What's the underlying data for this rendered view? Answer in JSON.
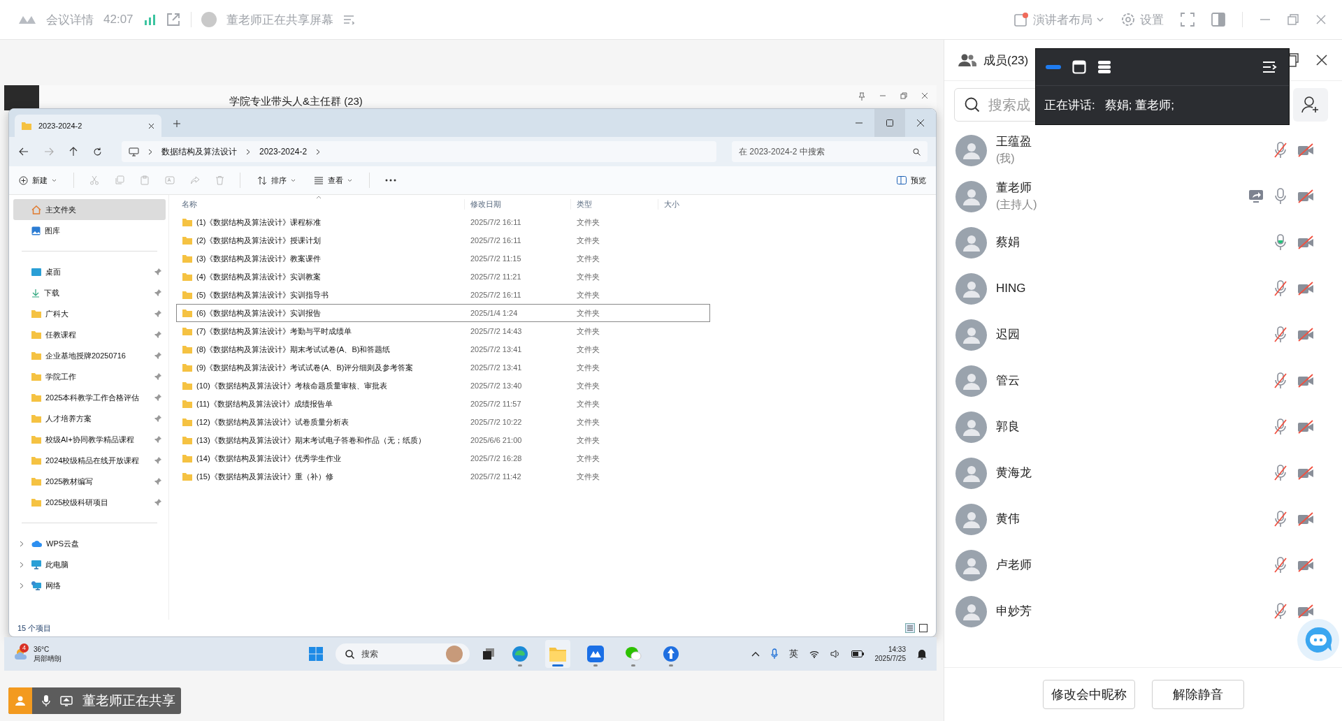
{
  "meeting_bar": {
    "title": "会议详情",
    "duration": "42:07",
    "sharing_status": "董老师正在共享屏幕",
    "layout_button": "演讲者布局",
    "settings_button": "设置"
  },
  "shared_screen": {
    "background_window": {
      "title": "学院专业带头人&主任群 (23)"
    },
    "explorer": {
      "tab": {
        "title": "2023-2024-2"
      },
      "breadcrumb": [
        "数据结构及算法设计",
        "2023-2024-2"
      ],
      "search": {
        "placeholder": "在 2023-2024-2 中搜索"
      },
      "toolbar": {
        "new": "新建",
        "sort": "排序",
        "view": "查看",
        "preview": "预览"
      },
      "sidebar": {
        "sections": [
          [
            {
              "label": "主文件夹",
              "kind": "home",
              "selected": true,
              "pinned": false
            },
            {
              "label": "图库",
              "kind": "gallery",
              "selected": false,
              "pinned": false
            }
          ],
          [
            {
              "label": "桌面",
              "kind": "desktop",
              "selected": false,
              "pinned": true
            },
            {
              "label": "下载",
              "kind": "download",
              "selected": false,
              "pinned": true
            },
            {
              "label": "广科大",
              "kind": "folder",
              "selected": false,
              "pinned": true
            },
            {
              "label": "任教课程",
              "kind": "folder",
              "selected": false,
              "pinned": true
            },
            {
              "label": "企业基地授牌20250716",
              "kind": "folder",
              "selected": false,
              "pinned": true
            },
            {
              "label": "学院工作",
              "kind": "folder",
              "selected": false,
              "pinned": true
            },
            {
              "label": "2025本科教学工作合格评估",
              "kind": "folder",
              "selected": false,
              "pinned": true
            },
            {
              "label": "人才培养方案",
              "kind": "folder",
              "selected": false,
              "pinned": true
            },
            {
              "label": "校级AI+协同教学精品课程",
              "kind": "folder",
              "selected": false,
              "pinned": true
            },
            {
              "label": "2024校级精品在线开放课程",
              "kind": "folder",
              "selected": false,
              "pinned": true
            },
            {
              "label": "2025教材编写",
              "kind": "folder",
              "selected": false,
              "pinned": true
            },
            {
              "label": "2025校级科研项目",
              "kind": "folder",
              "selected": false,
              "pinned": true
            }
          ],
          [
            {
              "label": "WPS云盘",
              "kind": "cloud",
              "selected": false,
              "pinned": false,
              "expanded": false
            },
            {
              "label": "此电脑",
              "kind": "computer",
              "selected": false,
              "pinned": false,
              "expanded": false
            },
            {
              "label": "网络",
              "kind": "network",
              "selected": false,
              "pinned": false,
              "expanded": false
            }
          ]
        ]
      },
      "columns": [
        "名称",
        "修改日期",
        "类型",
        "大小"
      ],
      "rows": [
        {
          "name": "(1)《数据结构及算法设计》课程标准",
          "modified": "2025/7/2 16:11",
          "type": "文件夹",
          "selected": false
        },
        {
          "name": "(2)《数据结构及算法设计》授课计划",
          "modified": "2025/7/2 16:11",
          "type": "文件夹",
          "selected": false
        },
        {
          "name": "(3)《数据结构及算法设计》教案课件",
          "modified": "2025/7/2 11:15",
          "type": "文件夹",
          "selected": false
        },
        {
          "name": "(4)《数据结构及算法设计》实训教案",
          "modified": "2025/7/2 11:21",
          "type": "文件夹",
          "selected": false
        },
        {
          "name": "(5)《数据结构及算法设计》实训指导书",
          "modified": "2025/7/2 16:11",
          "type": "文件夹",
          "selected": false
        },
        {
          "name": "(6)《数据结构及算法设计》实训报告",
          "modified": "2025/1/4 1:24",
          "type": "文件夹",
          "selected": true
        },
        {
          "name": "(7)《数据结构及算法设计》考勤与平时成绩单",
          "modified": "2025/7/2 14:43",
          "type": "文件夹",
          "selected": false
        },
        {
          "name": "(8)《数据结构及算法设计》期末考试试卷(A、B)和答题纸",
          "modified": "2025/7/2 13:41",
          "type": "文件夹",
          "selected": false
        },
        {
          "name": "(9)《数据结构及算法设计》考试试卷(A、B)评分细则及参考答案",
          "modified": "2025/7/2 13:41",
          "type": "文件夹",
          "selected": false
        },
        {
          "name": "(10)《数据结构及算法设计》考核命题质量审核、审批表",
          "modified": "2025/7/2 13:40",
          "type": "文件夹",
          "selected": false
        },
        {
          "name": "(11)《数据结构及算法设计》成绩报告单",
          "modified": "2025/7/2 11:57",
          "type": "文件夹",
          "selected": false
        },
        {
          "name": "(12)《数据结构及算法设计》试卷质量分析表",
          "modified": "2025/7/2 10:22",
          "type": "文件夹",
          "selected": false
        },
        {
          "name": "(13)《数据结构及算法设计》期末考试电子答卷和作品（无；纸质）",
          "modified": "2025/6/6 21:00",
          "type": "文件夹",
          "selected": false
        },
        {
          "name": "(14)《数据结构及算法设计》优秀学生作业",
          "modified": "2025/7/2 16:28",
          "type": "文件夹",
          "selected": false
        },
        {
          "name": "(15)《数据结构及算法设计》重（补）修",
          "modified": "2025/7/2 11:42",
          "type": "文件夹",
          "selected": false
        }
      ],
      "status": "15 个项目"
    },
    "taskbar": {
      "weather": {
        "badge": "4",
        "temperature": "36°C",
        "condition": "局部晴朗"
      },
      "search": {
        "placeholder": "搜索"
      },
      "ime": "英",
      "time": "14:33",
      "date": "2025/7/25"
    }
  },
  "sharing_badge": {
    "text": "董老师正在共享"
  },
  "members_panel": {
    "title": "成员(23)",
    "search": {
      "placeholder": "搜索成"
    },
    "speaking": {
      "label": "正在讲话:",
      "names": "蔡娟; 董老师;"
    },
    "members": [
      {
        "name": "王蕴盈",
        "role": "(我)",
        "sharing": false,
        "muted": true,
        "speaking": false
      },
      {
        "name": "董老师",
        "role": "(主持人)",
        "sharing": true,
        "muted": false,
        "speaking": false
      },
      {
        "name": "蔡娟",
        "sharing": false,
        "muted": false,
        "speaking": true
      },
      {
        "name": "HING",
        "sharing": false,
        "muted": true,
        "speaking": false
      },
      {
        "name": "迟园",
        "sharing": false,
        "muted": true,
        "speaking": false
      },
      {
        "name": "管云",
        "sharing": false,
        "muted": true,
        "speaking": false
      },
      {
        "name": "郭良",
        "sharing": false,
        "muted": true,
        "speaking": false
      },
      {
        "name": "黄海龙",
        "sharing": false,
        "muted": true,
        "speaking": false
      },
      {
        "name": "黄伟",
        "sharing": false,
        "muted": true,
        "speaking": false
      },
      {
        "name": "卢老师",
        "sharing": false,
        "muted": true,
        "speaking": false
      },
      {
        "name": "申妙芳",
        "sharing": false,
        "muted": true,
        "speaking": false
      }
    ],
    "buttons": [
      "修改会中昵称",
      "解除静音"
    ]
  }
}
